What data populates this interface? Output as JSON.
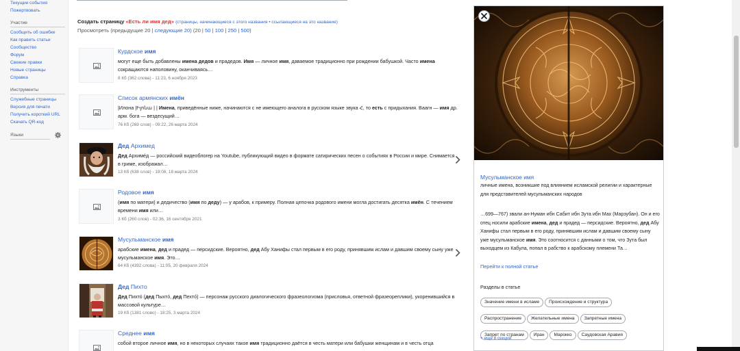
{
  "sidebar": {
    "nav": [
      "Текущие события",
      "Пожертвовать"
    ],
    "participation_heading": "Участие",
    "participation": [
      "Сообщить об ошибке",
      "Как править статьи",
      "Сообщество",
      "Форум",
      "Свежие правки",
      "Новые страницы",
      "Справка"
    ],
    "tools_heading": "Инструменты",
    "tools": [
      "Служебные страницы",
      "Версия для печати",
      "Получить короткий URL",
      "Скачать QR-код"
    ],
    "languages_heading": "Языки"
  },
  "header": {
    "create_prefix": "Создать страницу ",
    "create_title": "«Есть ли имя дед»",
    "create_links": "(страницы, начинающиеся с этого названия • ссылающиеся на это название)",
    "view_prefix": "Просмотреть (предыдущие 20 | ",
    "view_next": "следующие 20",
    "view_mid": ") (20 | ",
    "view_counts": [
      "50",
      "100",
      "250",
      "500"
    ],
    "view_suffix": ")"
  },
  "results": [
    {
      "title": [
        {
          "t": "Курдское "
        },
        {
          "t": "имя",
          "b": true
        }
      ],
      "snippet": [
        {
          "t": "могут еще быть добавлены "
        },
        {
          "t": "имена дедов",
          "b": true
        },
        {
          "t": " и прадедов. "
        },
        {
          "t": "Имя",
          "b": true
        },
        {
          "t": " — личное "
        },
        {
          "t": "имя",
          "b": true
        },
        {
          "t": ", даваемое традиционно при рождении бабушкой. Часто "
        },
        {
          "t": "имена",
          "b": true
        },
        {
          "t": " сокращаются наполовину, оканчиваясь…"
        }
      ],
      "meta": "8 Кб (362 слова) - 11:23, 6 ноября 2023",
      "thumb": "placeholder",
      "chevron": false
    },
    {
      "title": [
        {
          "t": "Список армянских "
        },
        {
          "t": "имён",
          "b": true
        }
      ],
      "snippet": [
        {
          "t": "|Илона |Իլոնա | | "
        },
        {
          "t": "Имена",
          "b": true
        },
        {
          "t": ", приведённые ниже, начинаются с не имеющего аналога в русском языке звука Հ, то "
        },
        {
          "t": "есть",
          "b": true
        },
        {
          "t": " с придыхания. Ваагн — "
        },
        {
          "t": "имя",
          "b": true
        },
        {
          "t": " др. арм. бога — вездесущий…"
        }
      ],
      "meta": "76 Кб (269 слов) - 09:22, 26 марта 2024",
      "thumb": "placeholder",
      "chevron": false
    },
    {
      "title": [
        {
          "t": "Дед",
          "b": true
        },
        {
          "t": " Архимед"
        }
      ],
      "snippet": [
        {
          "t": "Дед",
          "b": true
        },
        {
          "t": " Архиме́д — российский видеоблогер на Youtube, публикующий видео в формате сатирических песен о событиях в России и мире. Снимается в гриме, изображал…"
        }
      ],
      "meta": "13 Кб (638 слов) - 19:08, 18 марта 2024",
      "thumb": "archimed",
      "chevron": true
    },
    {
      "title": [
        {
          "t": "Родовое "
        },
        {
          "t": "имя",
          "b": true
        }
      ],
      "snippet": [
        {
          "t": "("
        },
        {
          "t": "имя",
          "b": true
        },
        {
          "t": " по матери) и дедичество ("
        },
        {
          "t": "имя",
          "b": true
        },
        {
          "t": " по "
        },
        {
          "t": "деду",
          "b": true
        },
        {
          "t": ") — у арабов, к примеру. Полная цепочка родового имени могла достигать десятка "
        },
        {
          "t": "имён",
          "b": true
        },
        {
          "t": ". С течением времени "
        },
        {
          "t": "имя",
          "b": true
        },
        {
          "t": " или…"
        }
      ],
      "meta": "3 Кб (260 слов) - 02:36, 16 сентября 2021",
      "thumb": "placeholder",
      "chevron": false
    },
    {
      "title": [
        {
          "t": "Мусульманское "
        },
        {
          "t": "имя",
          "b": true
        }
      ],
      "snippet": [
        {
          "t": "арабские "
        },
        {
          "t": "имена",
          "b": true
        },
        {
          "t": ", "
        },
        {
          "t": "дед",
          "b": true
        },
        {
          "t": " и прадед — персидские. Вероятно, "
        },
        {
          "t": "дед",
          "b": true
        },
        {
          "t": " Абу Ханифы стал первым в его роду, принявшим ислам и давшим своему сыну уже мусульманское "
        },
        {
          "t": "имя",
          "b": true
        },
        {
          "t": ". Это…"
        }
      ],
      "meta": "64 Кб (4392 слова) - 11:05, 20 февраля 2024",
      "thumb": "mosque",
      "chevron": true
    },
    {
      "title": [
        {
          "t": "Дед",
          "b": true
        },
        {
          "t": " Пихто"
        }
      ],
      "snippet": [
        {
          "t": "Дед",
          "b": true
        },
        {
          "t": " Пихто́ ("
        },
        {
          "t": "дед",
          "b": true
        },
        {
          "t": " Пыхто́, "
        },
        {
          "t": "дед",
          "b": true
        },
        {
          "t": " Пехто́) — персонаж русского диалогического фразеологизма (присловья, ответной фразеореплики), укоренившийся в массовой культуре…"
        }
      ],
      "meta": "19 Кб (1381 слово) - 18:25, 3 марта 2024",
      "thumb": "pihto",
      "chevron": false
    },
    {
      "title": [
        {
          "t": "Среднее "
        },
        {
          "t": "имя",
          "b": true
        }
      ],
      "snippet": [
        {
          "t": "собой второе личное "
        },
        {
          "t": "имя",
          "b": true
        },
        {
          "t": ", но в некоторых случаях такое "
        },
        {
          "t": "имя",
          "b": true
        },
        {
          "t": " традиционно даётся в честь матери или бабушки женщинам и в честь отца"
        }
      ],
      "meta": "",
      "thumb": "placeholder",
      "chevron": false
    }
  ],
  "preview": {
    "title": "Мусульманское имя",
    "description": "личные имена, возникшие под влиянием исламской религии и характерные для представителей мусульманских народов",
    "extract": [
      {
        "t": "…699—767) звали ан-Нуман ибн Сабит ибн Зута ибн Мах (Марзубан). Он и его отец носили арабские "
      },
      {
        "t": "имена",
        "b": true
      },
      {
        "t": ", "
      },
      {
        "t": "дед",
        "b": true
      },
      {
        "t": " и прадед — персидские. Вероятно, "
      },
      {
        "t": "дед",
        "b": true
      },
      {
        "t": " Абу Ханифы стал первым в его роду, принявшим ислам и давшим своему сыну уже мусульманское "
      },
      {
        "t": "имя",
        "b": true
      },
      {
        "t": ". Это соотносится с данными о том, что Зута был выходцем из Кабула, попал в рабство к арабскому племени Та…"
      }
    ],
    "read_more": "Перейти к полной статье",
    "sections_heading": "Разделы в статье",
    "sections": [
      "Значение имени в исламе",
      "Происхождение и структура",
      "Распространение",
      "Желательные имена",
      "Запретные имена",
      "Запрет по странам",
      "Иран",
      "Марокко",
      "Саудовская Аравия"
    ],
    "more_sections": "+ ещё 8 секций"
  },
  "colors": {
    "link": "#3366cc",
    "text": "#202122",
    "meta": "#72777d",
    "red_link": "#dd3333",
    "sidebar_bg": "#f6f6f6"
  },
  "icons": {
    "result_placeholder": "image-placeholder-icon",
    "result_chevron": "chevron-right-icon",
    "panel_close": "close-icon",
    "languages_settings": "gear-icon"
  }
}
